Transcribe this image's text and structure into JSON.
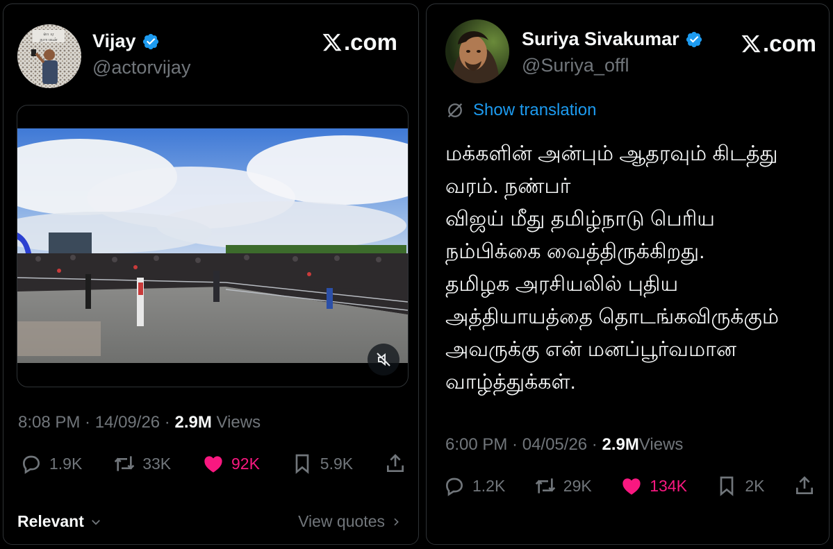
{
  "left_tweet": {
    "name": "Vijay",
    "handle": "@actorvijay",
    "source": ".com",
    "meta": {
      "time": "8:08 PM",
      "sep1": " · ",
      "date": "14/09/26",
      "sep2": " · ",
      "views_count": "2.9M",
      "views_label": " Views"
    },
    "actions": {
      "replies": "1.9K",
      "reposts": "33K",
      "likes": "92K",
      "bookmarks": "5.9K"
    },
    "footer": {
      "relevant": "Relevant",
      "view_quotes": "View quotes"
    }
  },
  "right_tweet": {
    "name": "Suriya Sivakumar",
    "handle": "@Suriya_offl",
    "source": ".com",
    "show_translation": "Show translation",
    "text_lines": [
      "மக்களின் அன்பும் ஆதரவும் கிடத்து",
      "வரம். நண்பர்",
      "விஜய் மீது தமிழ்நாடு பெரிய",
      "நம்பிக்கை வைத்திருக்கிறது.",
      "தமிழக அரசியலில் புதிய",
      "அத்தியாயத்தை தொடங்கவிருக்கும்",
      "அவருக்கு என் மனப்பூர்வமான",
      "வாழ்த்துக்கள்."
    ],
    "meta": {
      "time": "6:00 PM",
      "sep1": " · ",
      "date": "04/05/26",
      "sep2": " · ",
      "views_count": "2.9M",
      "views_label": "Views"
    },
    "actions": {
      "replies": "1.2K",
      "reposts": "29K",
      "likes": "134K",
      "bookmarks": "2K"
    }
  },
  "colors": {
    "background": "#000000",
    "verified": "#1d9bf0",
    "like": "#f91880",
    "link": "#1d9bf0",
    "muted": "#71767b"
  },
  "icons": [
    "verified-badge-icon",
    "x-logo-icon",
    "reply-icon",
    "repost-icon",
    "heart-icon",
    "bookmark-icon",
    "share-icon",
    "mute-icon",
    "translate-icon",
    "chevron-down-icon",
    "chevron-right-icon"
  ]
}
